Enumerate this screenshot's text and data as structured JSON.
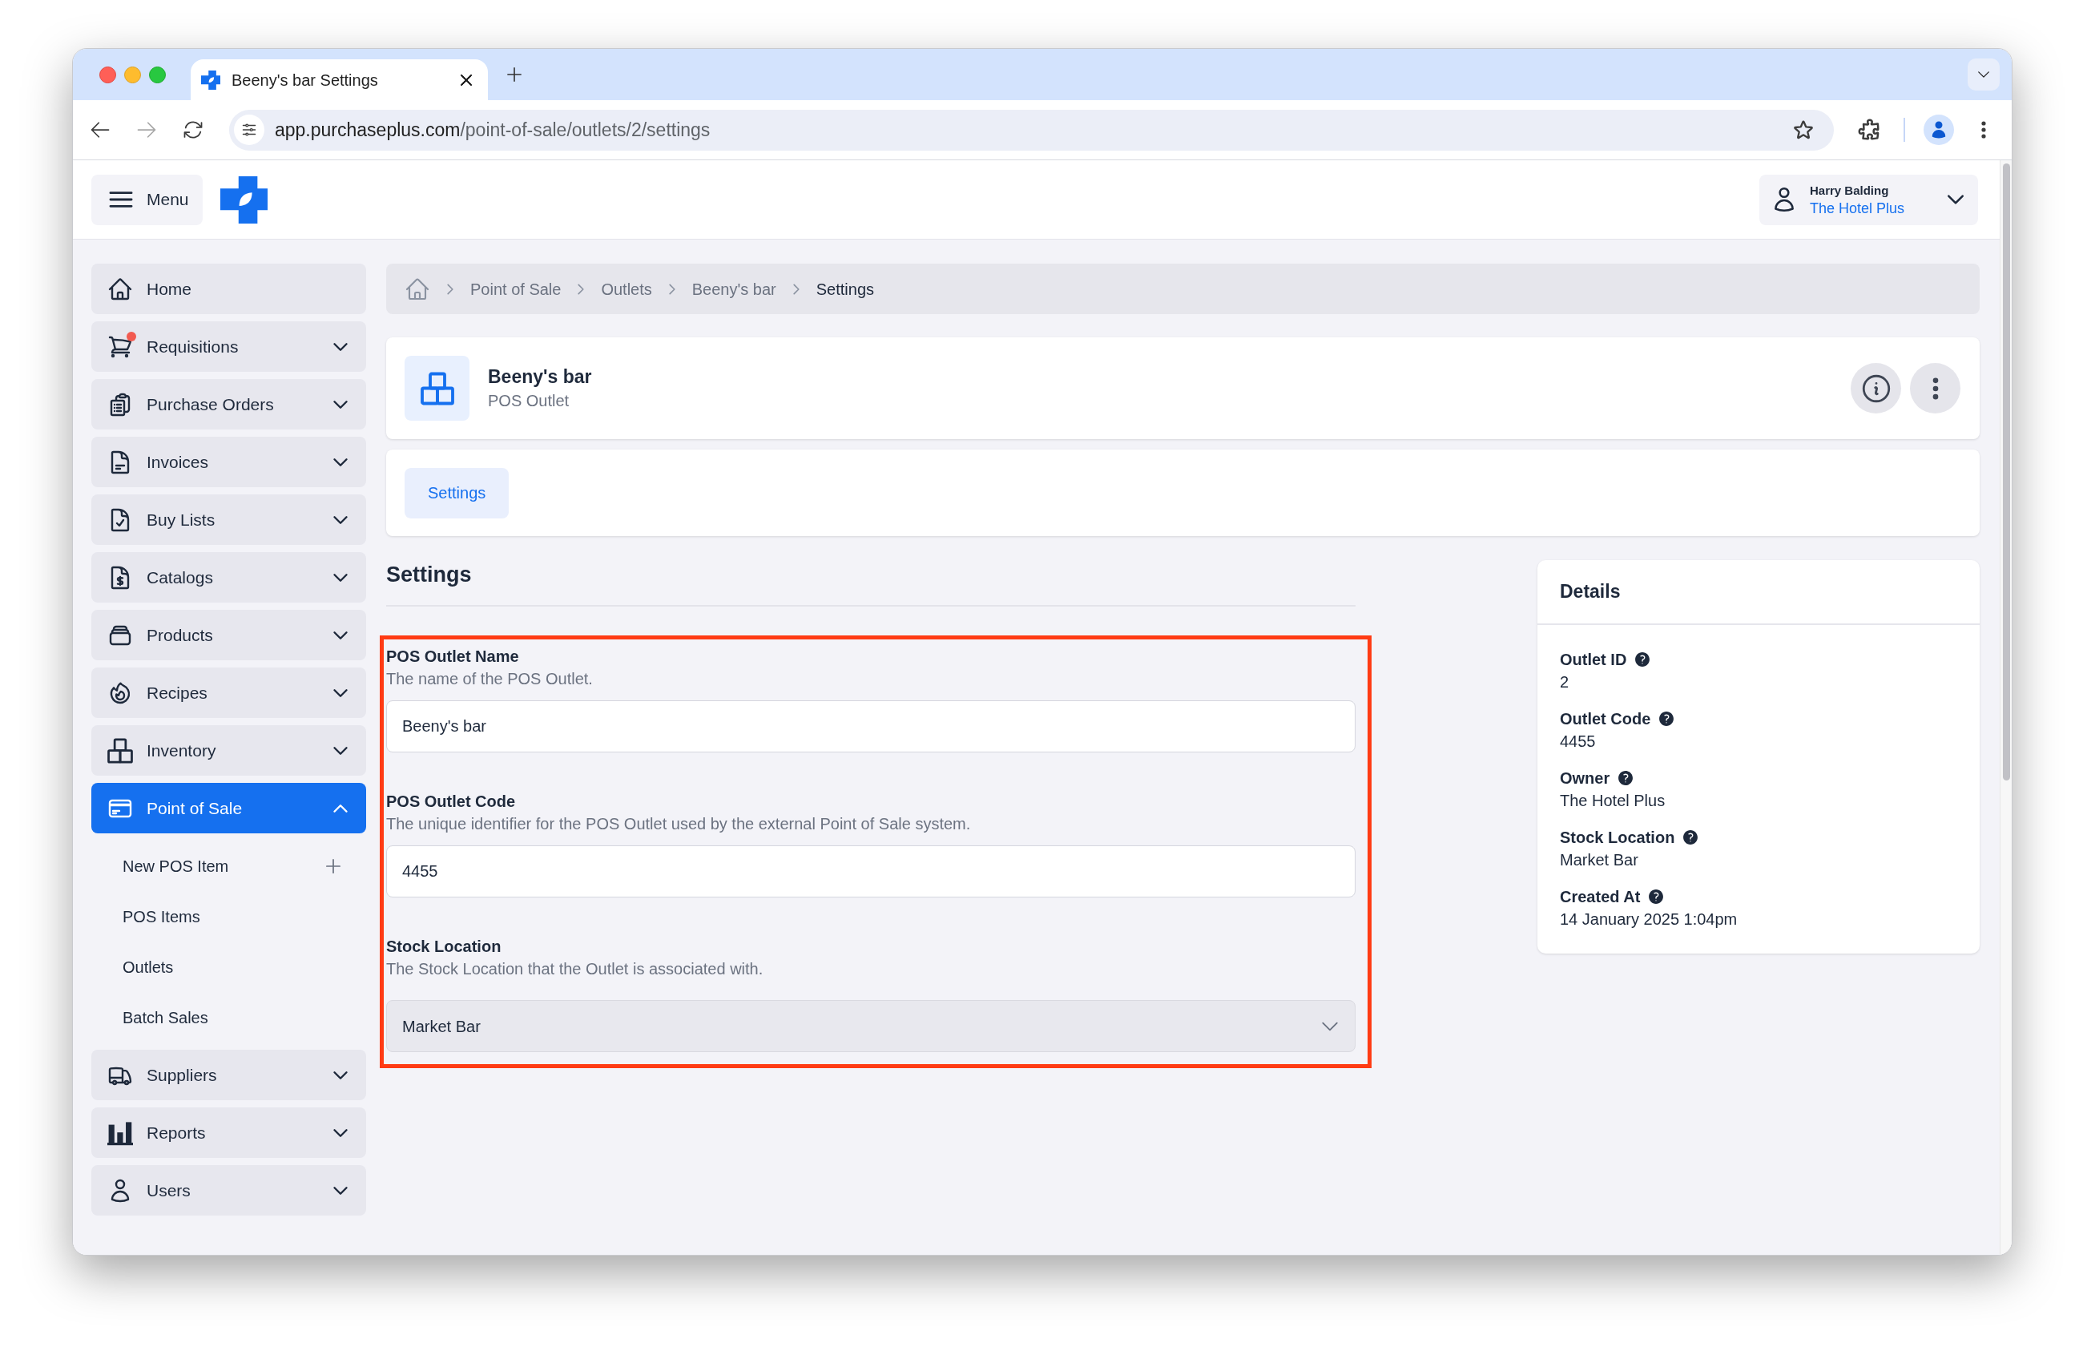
{
  "browser": {
    "tab": {
      "title": "Beeny's bar Settings",
      "selected": true
    },
    "url": {
      "host": "app.purchaseplus.com",
      "path": "/point-of-sale/outlets/2/settings"
    }
  },
  "header": {
    "menu_label": "Menu",
    "user": {
      "name": "Harry Balding",
      "organisation": "The Hotel Plus"
    }
  },
  "sidebar": {
    "items": [
      {
        "kind": "link",
        "label": "Home",
        "selected": false,
        "notification": false
      },
      {
        "kind": "group",
        "label": "Requisitions",
        "selected": false,
        "expanded": false,
        "notification": true
      },
      {
        "kind": "group",
        "label": "Purchase Orders",
        "selected": false,
        "expanded": false,
        "notification": false
      },
      {
        "kind": "group",
        "label": "Invoices",
        "selected": false,
        "expanded": false,
        "notification": false
      },
      {
        "kind": "group",
        "label": "Buy Lists",
        "selected": false,
        "expanded": false,
        "notification": false
      },
      {
        "kind": "group",
        "label": "Catalogs",
        "selected": false,
        "expanded": false,
        "notification": false
      },
      {
        "kind": "group",
        "label": "Products",
        "selected": false,
        "expanded": false,
        "notification": false
      },
      {
        "kind": "group",
        "label": "Recipes",
        "selected": false,
        "expanded": false,
        "notification": false
      },
      {
        "kind": "group",
        "label": "Inventory",
        "selected": false,
        "expanded": false,
        "notification": false
      },
      {
        "kind": "group",
        "label": "Point of Sale",
        "selected": true,
        "expanded": true,
        "notification": false,
        "children": [
          {
            "kind": "create",
            "label": "New POS Item",
            "selected": false
          },
          {
            "kind": "link",
            "label": "POS Items",
            "selected": false
          },
          {
            "kind": "link",
            "label": "Outlets",
            "selected": false
          },
          {
            "kind": "link",
            "label": "Batch Sales",
            "selected": false
          }
        ]
      },
      {
        "kind": "group",
        "label": "Suppliers",
        "selected": false,
        "expanded": false,
        "notification": false
      },
      {
        "kind": "group",
        "label": "Reports",
        "selected": false,
        "expanded": false,
        "notification": false
      },
      {
        "kind": "group",
        "label": "Users",
        "selected": false,
        "expanded": false,
        "notification": false
      }
    ]
  },
  "breadcrumb": [
    {
      "label": "Point of Sale",
      "current": false
    },
    {
      "label": "Outlets",
      "current": false
    },
    {
      "label": "Beeny's bar",
      "current": false
    },
    {
      "label": "Settings",
      "current": true
    }
  ],
  "outlet": {
    "name": "Beeny's bar",
    "type": "POS Outlet"
  },
  "tabs": [
    {
      "label": "Settings",
      "selected": true
    }
  ],
  "settings": {
    "title": "Settings",
    "highlighted": true,
    "fields": [
      {
        "kind": "text",
        "label": "POS Outlet Name",
        "description": "The name of the POS Outlet.",
        "value": "Beeny's bar"
      },
      {
        "kind": "text",
        "label": "POS Outlet Code",
        "description": "The unique identifier for the POS Outlet used by the external Point of Sale system.",
        "value": "4455"
      },
      {
        "kind": "select",
        "label": "Stock Location",
        "description": "The Stock Location that the Outlet is associated with.",
        "value": "Market Bar"
      }
    ]
  },
  "details": {
    "title": "Details",
    "items": [
      {
        "label": "Outlet ID",
        "value": "2"
      },
      {
        "label": "Outlet Code",
        "value": "4455"
      },
      {
        "label": "Owner",
        "value": "The Hotel Plus"
      },
      {
        "label": "Stock Location",
        "value": "Market Bar"
      },
      {
        "label": "Created At",
        "value": "14 January 2025 1:04pm"
      }
    ]
  }
}
